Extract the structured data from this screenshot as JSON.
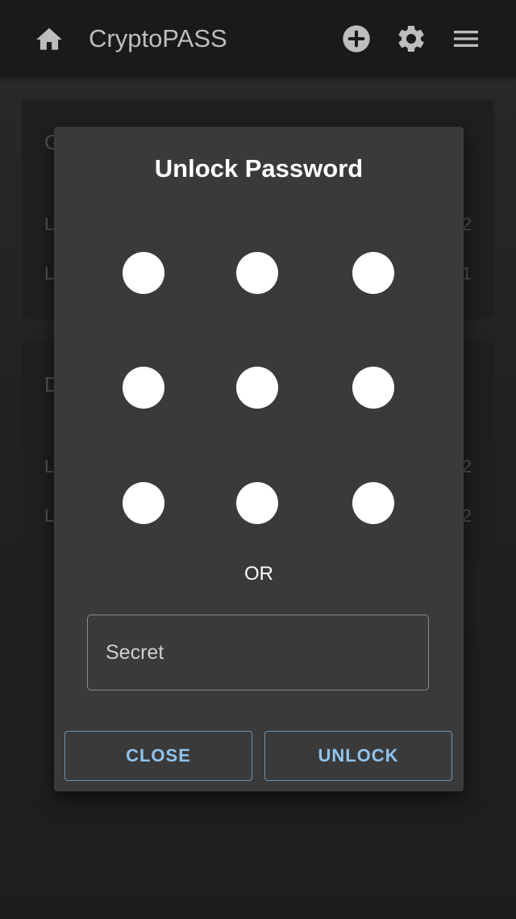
{
  "app_bar": {
    "title": "CryptoPASS",
    "icons": [
      "home-icon",
      "add-circle-icon",
      "settings-gear-icon",
      "hamburger-menu-icon"
    ],
    "icon_color": "#bdbdbd"
  },
  "background_cards": [
    {
      "title": "G",
      "rows": [
        {
          "label": "L",
          "value": "2"
        },
        {
          "label": "L",
          "value": "1"
        }
      ]
    },
    {
      "title": "D",
      "rows": [
        {
          "label": "L",
          "value": "2"
        },
        {
          "label": "L",
          "value": "2"
        }
      ]
    }
  ],
  "dialog": {
    "title": "Unlock Password",
    "pattern_grid": {
      "rows": 3,
      "cols": 3,
      "dot_color": "#ffffff"
    },
    "separator_text": "OR",
    "secret_input": {
      "placeholder": "Secret",
      "value": ""
    },
    "buttons": {
      "close_label": "CLOSE",
      "unlock_label": "UNLOCK"
    },
    "accent_color": "#8fc3ee",
    "background_color": "#3a3a3a"
  }
}
